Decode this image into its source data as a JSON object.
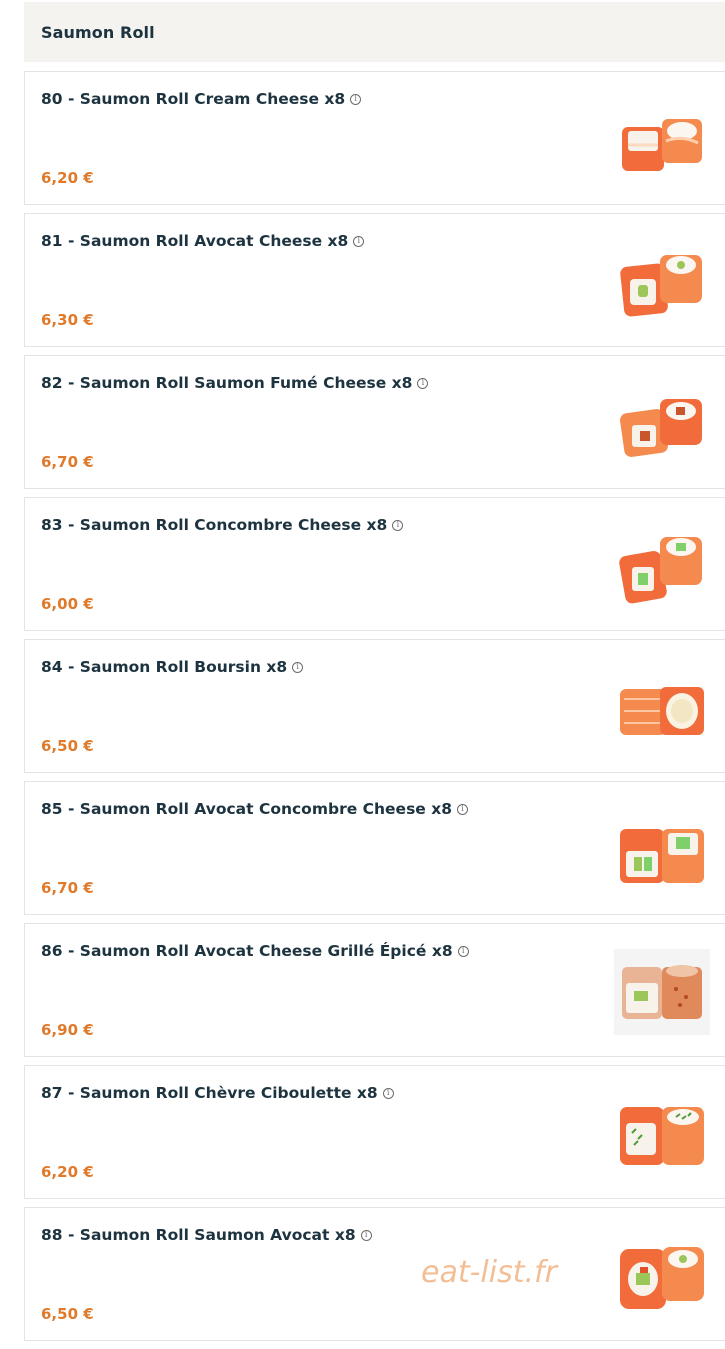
{
  "section": {
    "title": "Saumon Roll"
  },
  "items": [
    {
      "name": "80 - Saumon Roll Cream Cheese x8",
      "price": "6,20 €",
      "photo": "cream",
      "info_icon": "info-icon"
    },
    {
      "name": "81 - Saumon Roll Avocat Cheese x8",
      "price": "6,30 €",
      "photo": "avocado",
      "info_icon": "info-icon"
    },
    {
      "name": "82 - Saumon Roll Saumon Fumé Cheese x8",
      "price": "6,70 €",
      "photo": "smoked",
      "info_icon": "info-icon"
    },
    {
      "name": "83 - Saumon Roll Concombre Cheese x8",
      "price": "6,00 €",
      "photo": "cucumber",
      "info_icon": "info-icon"
    },
    {
      "name": "84 - Saumon Roll Boursin x8",
      "price": "6,50 €",
      "photo": "boursin",
      "info_icon": "info-icon"
    },
    {
      "name": "85 - Saumon Roll Avocat Concombre Cheese x8",
      "price": "6,70 €",
      "photo": "avocado-cucumber",
      "info_icon": "info-icon"
    },
    {
      "name": "86 - Saumon Roll Avocat Cheese Grillé Épicé x8",
      "price": "6,90 €",
      "photo": "grilled",
      "info_icon": "info-icon"
    },
    {
      "name": "87 - Saumon Roll Chèvre Ciboulette x8",
      "price": "6,20 €",
      "photo": "chevre",
      "info_icon": "info-icon"
    },
    {
      "name": "88 - Saumon Roll Saumon Avocat x8",
      "price": "6,50 €",
      "photo": "salmon-avocado",
      "info_icon": "info-icon"
    }
  ],
  "watermark": "eat-list.fr",
  "colors": {
    "title": "#1d3440",
    "price": "#e07a2a",
    "header_bg": "#f5f3f0",
    "salmon": "#f26b3a",
    "rice": "#f7f2ea",
    "avocado": "#9bc65a",
    "cucumber": "#7fcf6a"
  }
}
